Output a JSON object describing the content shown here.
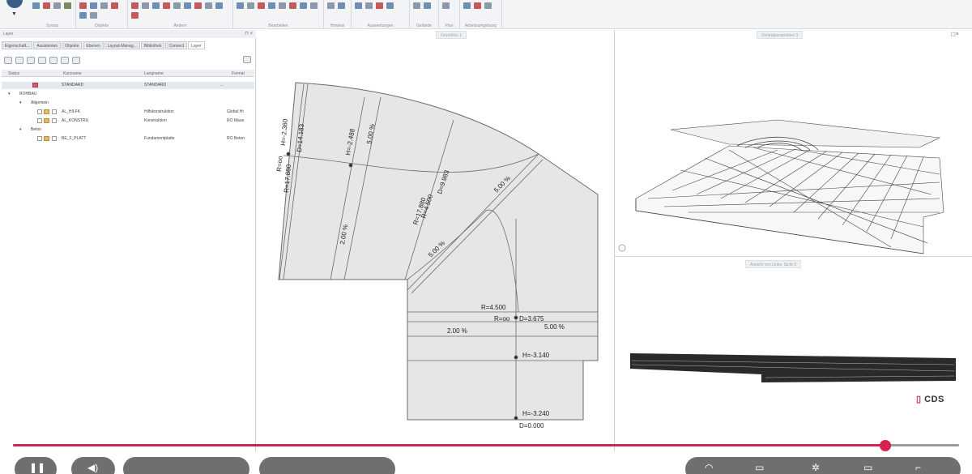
{
  "ribbon": {
    "groups": [
      {
        "label": "Syntax"
      },
      {
        "label": "Objekte"
      },
      {
        "label": "Ändern"
      },
      {
        "label": "Bearbeiten"
      },
      {
        "label": "Hinweis"
      },
      {
        "label": "Auswertungen"
      },
      {
        "label": "Gelände"
      },
      {
        "label": "Plan"
      },
      {
        "label": "Arbeitsumgebung"
      }
    ]
  },
  "layer_panel": {
    "title": "Layer",
    "tabs": [
      "Eigenschaft...",
      "Assistenten",
      "Objekte",
      "Ebenen",
      "Layout-Manag...",
      "Bibliothek",
      "Connect",
      "Layer"
    ],
    "columns": [
      "Status",
      "Kurzname",
      "Langname",
      "Format"
    ],
    "rows": [
      {
        "kurz": "STANDARD",
        "lang": "STANDARD",
        "format": "..."
      },
      {
        "kurz": "ROHBAU",
        "lang": "",
        "format": ""
      },
      {
        "kurz": "Allgemein",
        "lang": "",
        "format": ""
      },
      {
        "kurz": "AL_HILFK",
        "lang": "Hilfskonstruktion",
        "format": "Global Hi"
      },
      {
        "kurz": "AL_KONSTRU",
        "lang": "Konstruktion",
        "format": "RO Maue"
      },
      {
        "kurz": "Beton",
        "lang": "",
        "format": ""
      },
      {
        "kurz": "BE_F_PLATT",
        "lang": "Fundamentplatte",
        "format": "RO Beton"
      }
    ]
  },
  "viewports": {
    "plan_title": "Grundriss 1",
    "perspective_title": "Zentralperspektive 3",
    "section_title": "Ansicht von Links: Sicht 3"
  },
  "drawing": {
    "labels": {
      "h_2360": "H=-2.360",
      "d_14183": "D=14.183",
      "r_oo_top": "R=oo",
      "r_17880_a": "R=17.880",
      "h_2488": "H=-2.488",
      "pct_5_a": "5.00 %",
      "d_9983": "D=9.983",
      "r_4500_a": "R=4.500",
      "r_17880_b": "R=17.880",
      "pct_5_b": "5.00 %",
      "pct_2_a": "2.00 %",
      "pct_5_c": "5.00 %",
      "r_4500_b": "R=4.500",
      "r_oo_b": "R=oo",
      "d_3675": "D=3.675",
      "pct_5_d": "5.00 %",
      "pct_2_b": "2.00 %",
      "h_3140": "H=-3.140",
      "h_3240": "H=-3.240",
      "d_0000": "D=0.000"
    }
  },
  "branding": {
    "logo_text": "CDS"
  },
  "player": {
    "progress": 0.9221,
    "colors": {
      "accent": "#d6224e",
      "track": "#9a9a9a"
    },
    "controls": [
      "play-pause-icon",
      "volume-icon",
      "time-display",
      "chapter-display",
      "settings-icon",
      "subtitles-icon",
      "gear-icon",
      "miniplayer-icon",
      "fullscreen-icon"
    ]
  }
}
